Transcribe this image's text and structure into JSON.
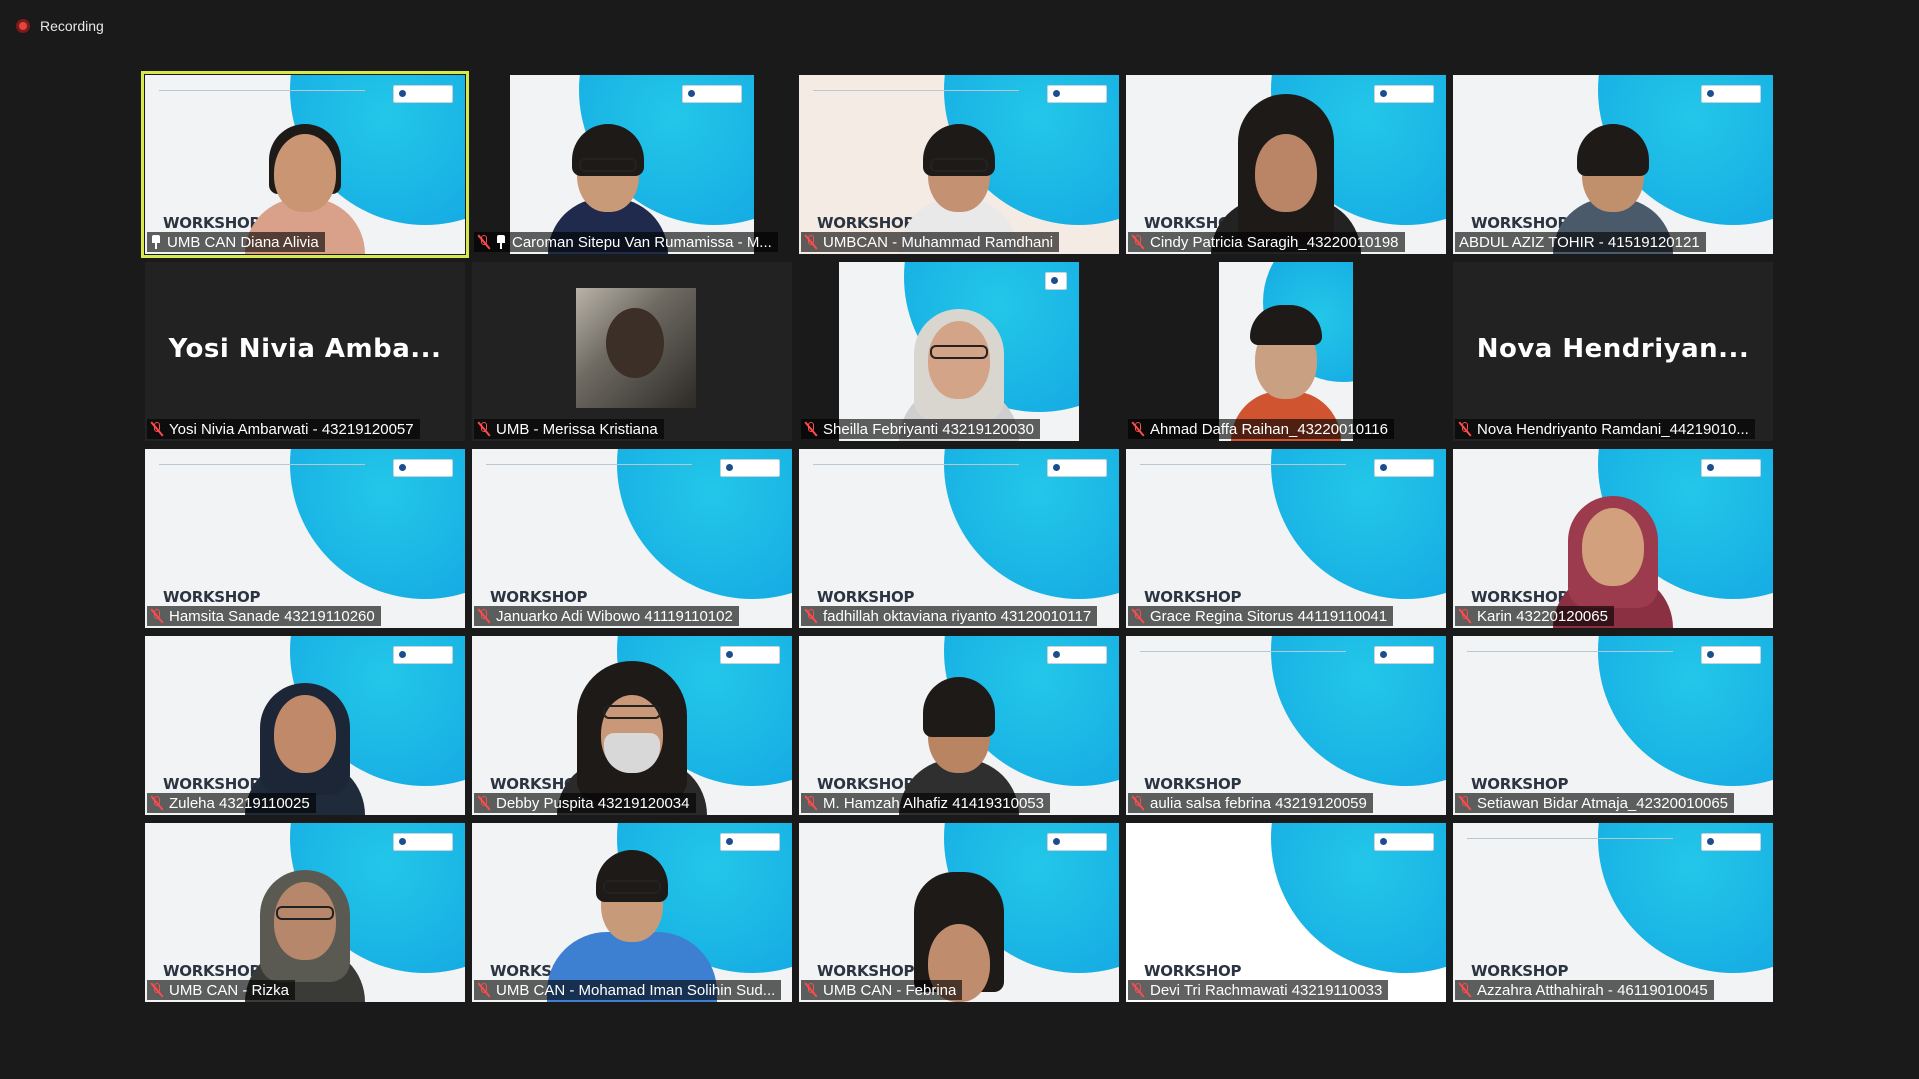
{
  "recording": {
    "label": "Recording"
  },
  "colors": {
    "active_speaker_border": "#d7e84a",
    "muted_icon": "#ff4b4b",
    "slide_accent": "#14a9e3"
  },
  "slide": {
    "watermark": "WORKSHOP"
  },
  "participants": [
    {
      "name": "UMB CAN Diana Alivia",
      "video": "presenter",
      "pinned": true,
      "active": true
    },
    {
      "name": "Caroman Sitepu Van Rumamissa - M...",
      "video": "camera",
      "pinned": true
    },
    {
      "name": "UMBCAN - Muhammad Ramdhani",
      "video": "camera"
    },
    {
      "name": "Cindy Patricia Saragih_43220010198",
      "video": "camera"
    },
    {
      "name": "ABDUL AZIZ TOHIR - 41519120121",
      "video": "camera"
    },
    {
      "name": "Yosi Nivia Ambarwati - 43219120057",
      "video": "name-only",
      "display_name": "Yosi  Nivia  Amba..."
    },
    {
      "name": "UMB - Merissa Kristiana",
      "video": "photo"
    },
    {
      "name": "Sheilla Febriyanti 43219120030",
      "video": "camera"
    },
    {
      "name": "Ahmad Daffa Raihan_43220010116",
      "video": "camera"
    },
    {
      "name": "Nova Hendriyanto Ramdani_44219010...",
      "video": "name-only",
      "display_name": "Nova  Hendriyan..."
    },
    {
      "name": "Hamsita Sanade 43219110260",
      "video": "slide"
    },
    {
      "name": "Januarko Adi Wibowo 41119110102",
      "video": "slide"
    },
    {
      "name": "fadhillah oktaviana riyanto 43120010117",
      "video": "slide"
    },
    {
      "name": "Grace Regina Sitorus 44119110041",
      "video": "slide"
    },
    {
      "name": "Karin 43220120065",
      "video": "camera"
    },
    {
      "name": "Zuleha 43219110025",
      "video": "camera"
    },
    {
      "name": "Debby Puspita 43219120034",
      "video": "camera"
    },
    {
      "name": "M. Hamzah Alhafiz 41419310053",
      "video": "camera"
    },
    {
      "name": "aulia salsa febrina 43219120059",
      "video": "slide"
    },
    {
      "name": "Setiawan Bidar Atmaja_42320010065",
      "video": "slide"
    },
    {
      "name": "UMB CAN - Rizka",
      "video": "camera"
    },
    {
      "name": "UMB CAN - Mohamad Iman Solihin Sud...",
      "video": "camera"
    },
    {
      "name": "UMB CAN - Febrina",
      "video": "camera"
    },
    {
      "name": "Devi Tri Rachmawati 43219110033",
      "video": "slide"
    },
    {
      "name": "Azzahra Atthahirah - 46119010045",
      "video": "slide"
    }
  ]
}
